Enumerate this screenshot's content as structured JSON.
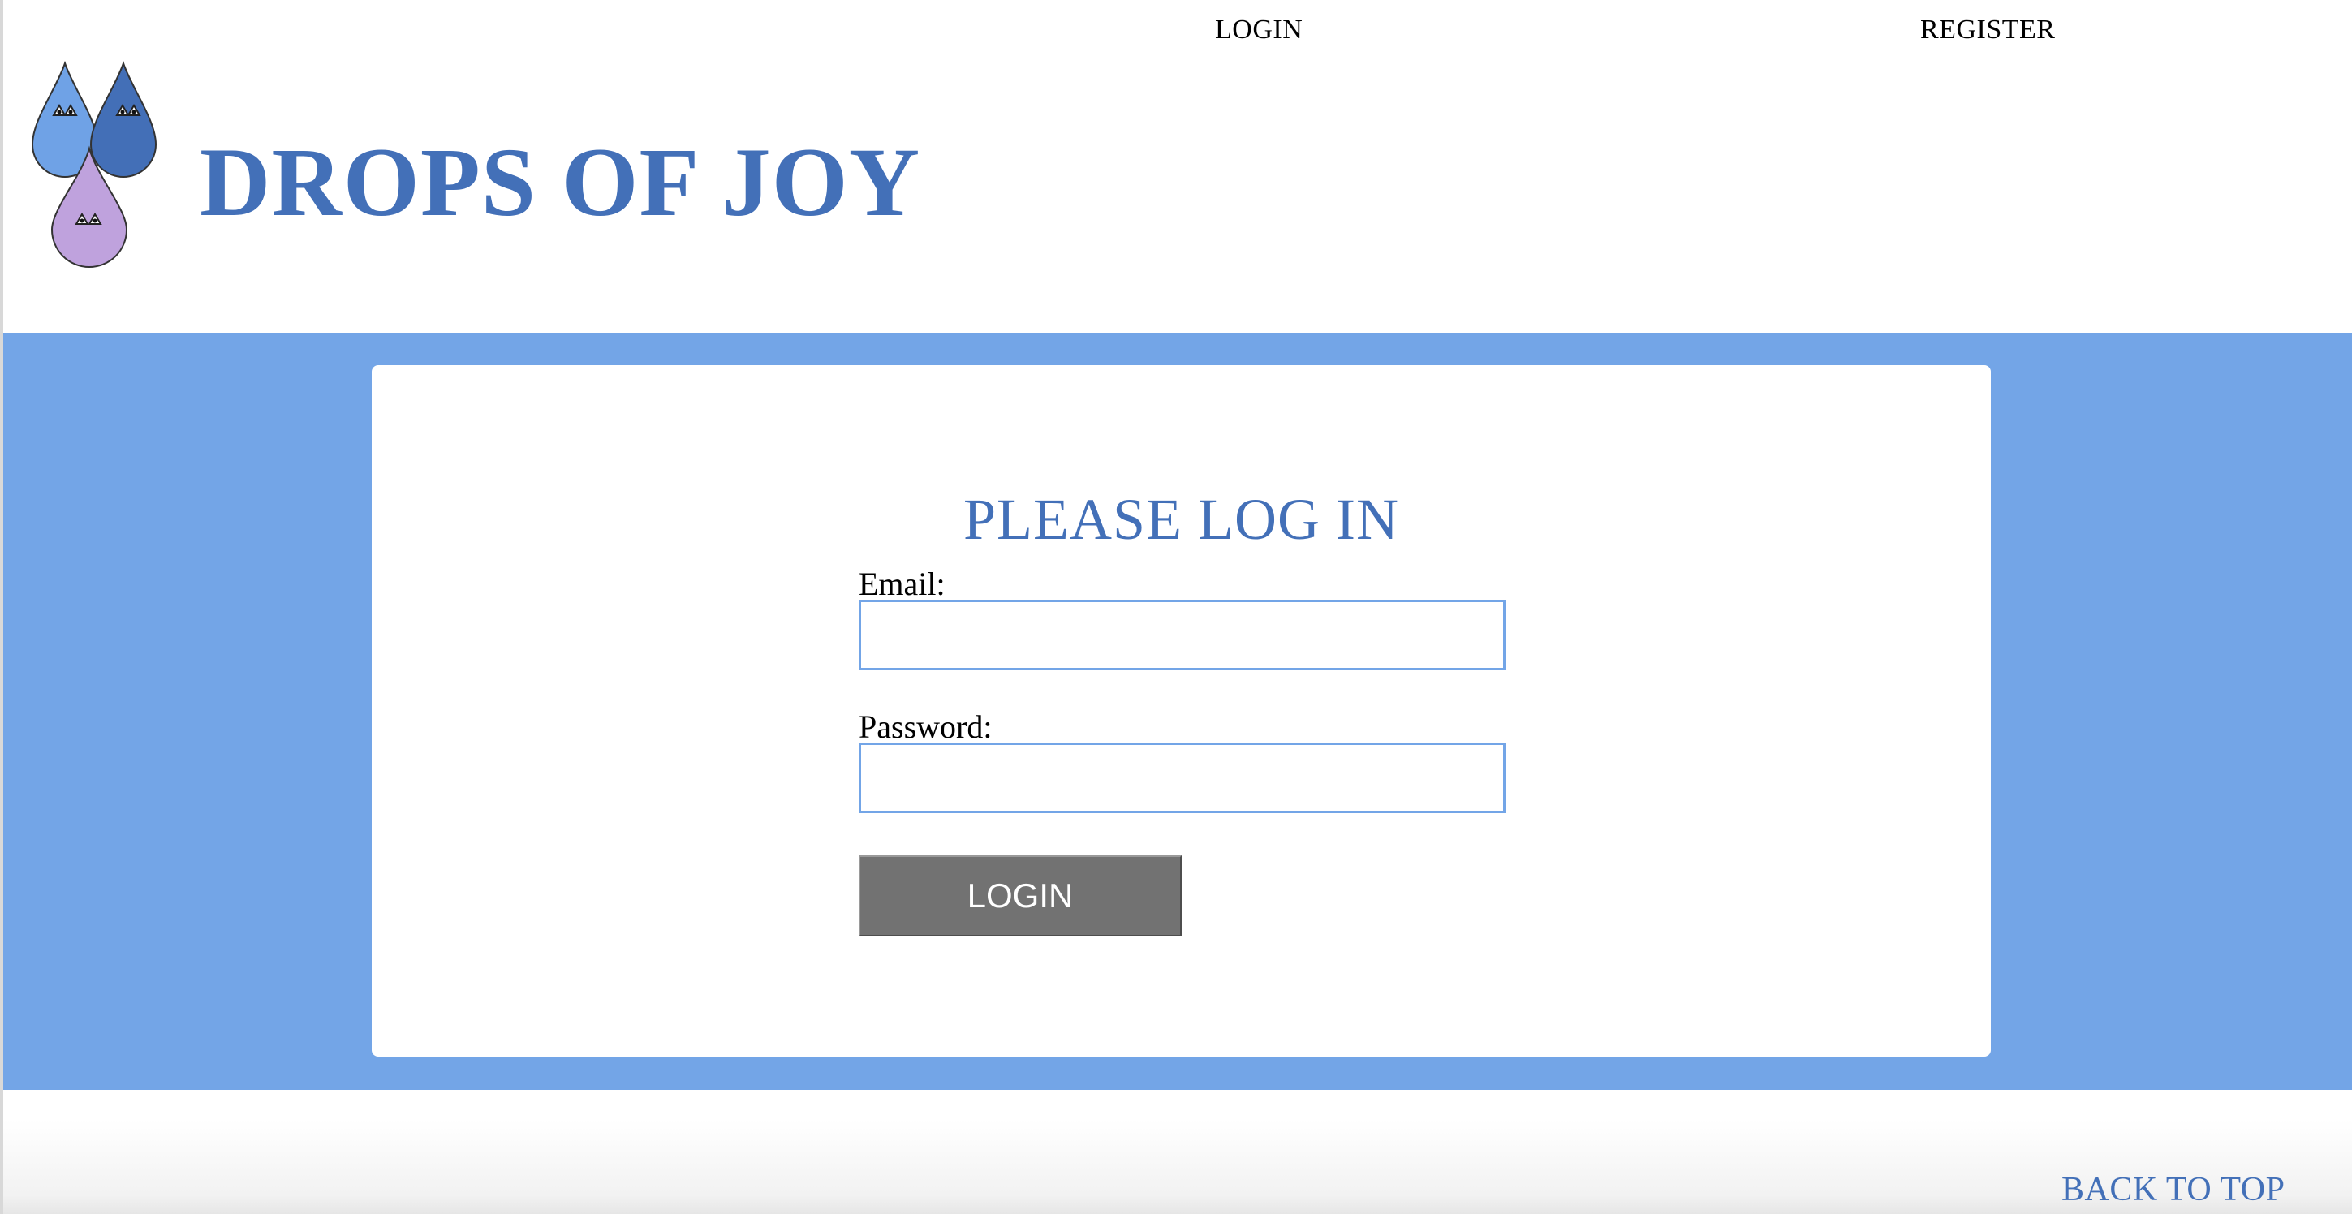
{
  "nav": {
    "login_label": "LOGIN",
    "register_label": "REGISTER"
  },
  "brand": {
    "title": "DROPS OF JOY",
    "logo_icon": "water-drops-logo",
    "color": "#4370b8"
  },
  "login_form": {
    "heading": "PLEASE LOG IN",
    "email_label": "Email:",
    "email_value": "",
    "password_label": "Password:",
    "password_value": "",
    "submit_label": "LOGIN"
  },
  "footer": {
    "back_to_top_label": "BACK TO TOP"
  },
  "colors": {
    "band_background": "#73a5e7",
    "accent": "#4370b8",
    "button_background": "#727272",
    "drop_light_blue": "#6fa2e6",
    "drop_dark_blue": "#436fb7",
    "drop_lavender": "#bfa2dd"
  }
}
